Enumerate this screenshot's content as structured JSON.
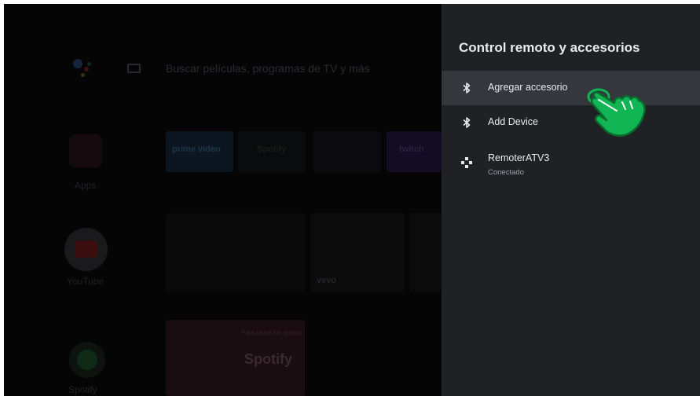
{
  "home": {
    "search_placeholder": "Buscar películas, programas de TV y más",
    "apps_label": "Apps",
    "youtube_label": "YouTube",
    "spotify_label": "Spotify",
    "channels": [
      "prime video",
      "Spotify",
      "",
      "twitch"
    ],
    "vevo_label": "vevo",
    "spotify_card_label": "Spotify",
    "spotify_card_caption": "Para todos los gustos"
  },
  "panel": {
    "title": "Control remoto y accesorios",
    "items": [
      {
        "label": "Agregar accesorio",
        "icon": "bluetooth-icon",
        "focused": true
      },
      {
        "label": "Add Device",
        "icon": "bluetooth-icon",
        "focused": false
      },
      {
        "label": "RemoterATV3",
        "sublabel": "Conectado",
        "icon": "gamepad-icon",
        "focused": false
      }
    ]
  },
  "colors": {
    "panel_bg": "#1f2124",
    "focused_row": "#34373b",
    "hand_fill": "#12b553",
    "hand_outline": "#0a6b2e"
  }
}
